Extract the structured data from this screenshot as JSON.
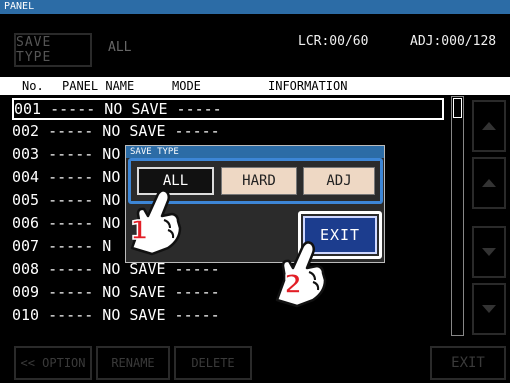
{
  "title_bar": "PANEL",
  "save_type": {
    "button_label": "SAVE TYPE",
    "value": "ALL"
  },
  "status": {
    "lcr": "LCR:00/60",
    "adj": "ADJ:000/128"
  },
  "columns": [
    "No.",
    "PANEL NAME",
    "MODE",
    "INFORMATION"
  ],
  "rows": [
    "001 ----- NO SAVE -----",
    "002 ----- NO SAVE -----",
    "003 ----- NO",
    "004 ----- NO",
    "005 ----- NO",
    "006 ----- NO",
    "007 ----- N",
    "008 ----- NO SAVE -----",
    "009 ----- NO SAVE -----",
    "010 ----- NO SAVE -----"
  ],
  "bottom_buttons": {
    "option": "<< OPTION",
    "rename": "RENAME",
    "delete": "DELETE",
    "exit": "EXIT"
  },
  "dialog": {
    "title": "SAVE TYPE",
    "options": {
      "all": "ALL",
      "hard": "HARD",
      "adj": "ADJ"
    },
    "exit": "EXIT"
  },
  "callouts": {
    "step1": "1",
    "step2": "2"
  },
  "colors": {
    "title_bar": "#2c6ca6",
    "highlight": "#3d86d6",
    "exit_button": "#1c3d8e",
    "option_bg": "#eed8c4",
    "callout_number": "#e21e26"
  }
}
